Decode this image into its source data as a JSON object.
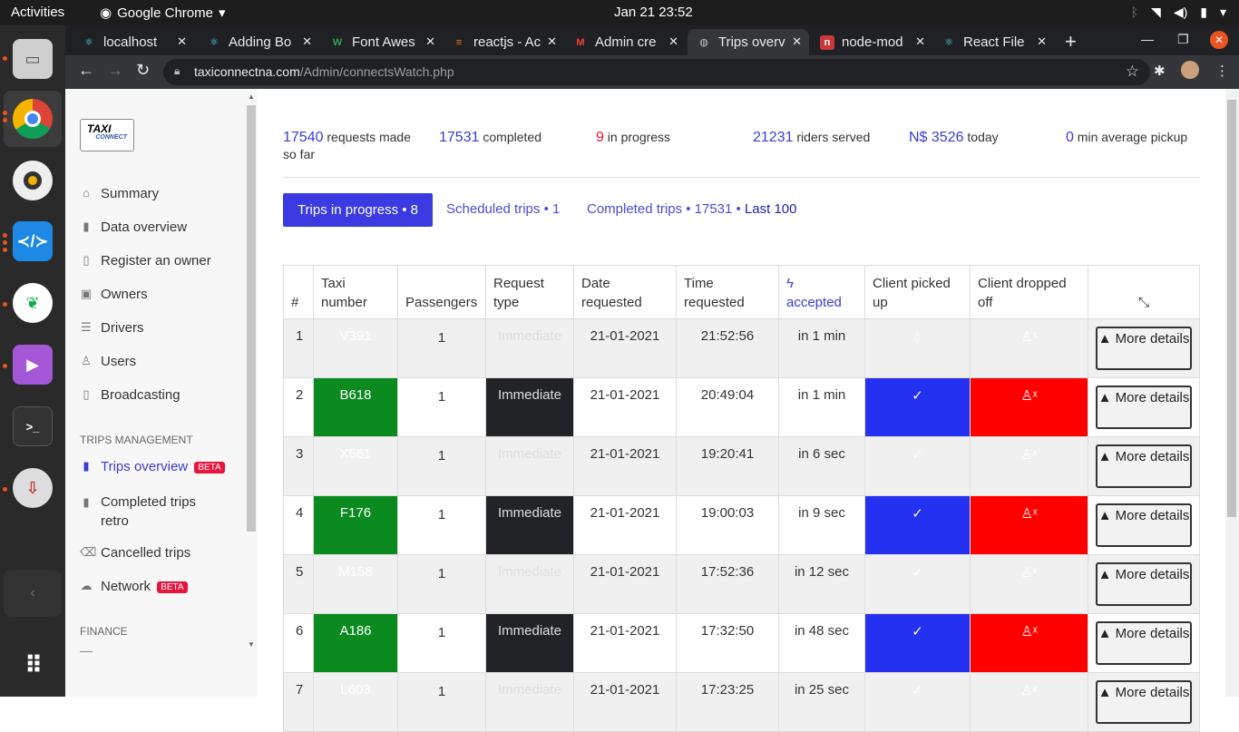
{
  "system": {
    "activities": "Activities",
    "app_name": "Google Chrome",
    "clock": "Jan 21  23:52"
  },
  "browser": {
    "tabs": [
      {
        "label": "localhost",
        "icon": "react-icon",
        "color": "#61dafb"
      },
      {
        "label": "Adding Bo",
        "icon": "react-icon",
        "color": "#61dafb"
      },
      {
        "label": "Font Awes",
        "icon": "font-awesome-icon",
        "color": "#2ea44f"
      },
      {
        "label": "reactjs - Ac",
        "icon": "stackoverflow-icon",
        "color": "#f48024"
      },
      {
        "label": "Admin cre",
        "icon": "gmail-icon",
        "color": "#ea4335"
      },
      {
        "label": "Trips overv",
        "icon": "globe-icon",
        "color": "#bdc1c6",
        "active": true
      },
      {
        "label": "node-mod",
        "icon": "npm-icon",
        "color": "#cb3837"
      },
      {
        "label": "React File",
        "icon": "react-icon",
        "color": "#61dafb"
      }
    ],
    "url_domain": "taxiconnectna.com",
    "url_path": "/Admin/connectsWatch.php"
  },
  "sidebar": {
    "logo_main": "TAXI",
    "logo_sub": "CONNECT",
    "items": [
      {
        "label": "Summary",
        "icon": "home-icon"
      },
      {
        "label": "Data overview",
        "icon": "bar-chart-icon"
      },
      {
        "label": "Register an owner",
        "icon": "file-icon"
      },
      {
        "label": "Owners",
        "icon": "briefcase-icon"
      },
      {
        "label": "Drivers",
        "icon": "database-icon"
      },
      {
        "label": "Users",
        "icon": "user-icon"
      },
      {
        "label": "Broadcasting",
        "icon": "phone-icon"
      }
    ],
    "section_trips": "TRIPS MANAGEMENT",
    "trip_items": [
      {
        "label": "Trips overview",
        "icon": "bar-chart-icon",
        "badge": "BETA",
        "active": true
      },
      {
        "label": "Completed trips retro",
        "icon": "bar-chart-icon"
      },
      {
        "label": "Cancelled trips",
        "icon": "backspace-icon"
      },
      {
        "label": "Network",
        "icon": "cloud-icon",
        "badge": "BETA"
      }
    ],
    "section_finance": "FINANCE"
  },
  "stats": {
    "requests_num": "17540",
    "requests_label": "requests made so far",
    "completed_num": "17531",
    "completed_label": "completed",
    "progress_num": "9",
    "progress_label": "in progress",
    "riders_num": "21231",
    "riders_label": "riders served",
    "today_num": "N$ 3526",
    "today_label": "today",
    "pickup_num": "0",
    "pickup_label": "min average pickup"
  },
  "trip_tabs": {
    "progress": "Trips in progress • 8",
    "scheduled": "Scheduled trips • 1",
    "completed": "Completed trips • 17531 •",
    "last100": "Last 100"
  },
  "table": {
    "headers": {
      "index": "#",
      "taxi": "Taxi number",
      "passengers": "Passengers",
      "request_type": "Request type",
      "date": "Date requested",
      "time": "Time requested",
      "accepted": "accepted",
      "picked": "Client picked up",
      "dropped": "Client dropped off"
    },
    "more_label": "▲ More details",
    "rows": [
      {
        "n": "1",
        "taxi": "V391",
        "pass": "1",
        "type": "Immediate",
        "date": "21-01-2021",
        "time": "21:52:56",
        "acc": "in 1 min",
        "picked": false
      },
      {
        "n": "2",
        "taxi": "B618",
        "pass": "1",
        "type": "Immediate",
        "date": "21-01-2021",
        "time": "20:49:04",
        "acc": "in 1 min",
        "picked": true
      },
      {
        "n": "3",
        "taxi": "X561",
        "pass": "1",
        "type": "Immediate",
        "date": "21-01-2021",
        "time": "19:20:41",
        "acc": "in 6 sec",
        "picked": true
      },
      {
        "n": "4",
        "taxi": "F176",
        "pass": "1",
        "type": "Immediate",
        "date": "21-01-2021",
        "time": "19:00:03",
        "acc": "in 9 sec",
        "picked": true
      },
      {
        "n": "5",
        "taxi": "M158",
        "pass": "1",
        "type": "Immediate",
        "date": "21-01-2021",
        "time": "17:52:36",
        "acc": "in 12 sec",
        "picked": true
      },
      {
        "n": "6",
        "taxi": "A186",
        "pass": "1",
        "type": "Immediate",
        "date": "21-01-2021",
        "time": "17:32:50",
        "acc": "in 48 sec",
        "picked": true
      },
      {
        "n": "7",
        "taxi": "L603",
        "pass": "1",
        "type": "Immediate",
        "date": "21-01-2021",
        "time": "17:23:25",
        "acc": "in 25 sec",
        "picked": true
      }
    ]
  }
}
